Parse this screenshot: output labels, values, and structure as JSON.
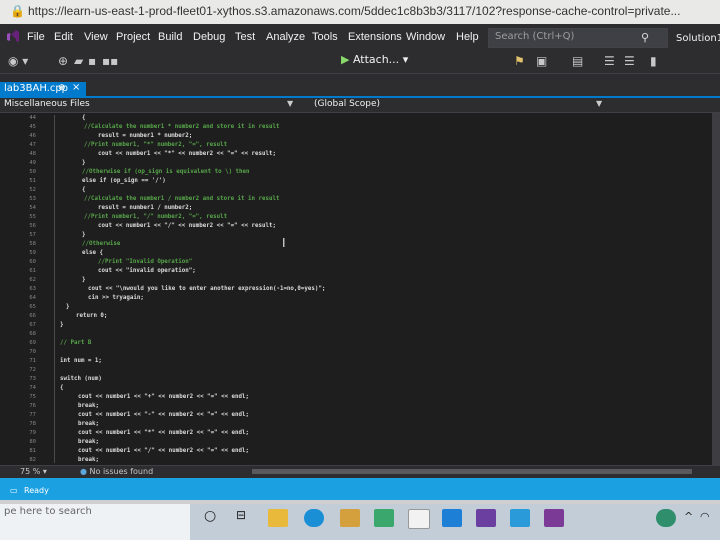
{
  "browser": {
    "lock": "🔒",
    "url": "https://learn-us-east-1-prod-fleet01-xythos.s3.amazonaws.com/5ddec1c8b3b3/3117/102?response-cache-control=private..."
  },
  "menu": [
    "File",
    "Edit",
    "View",
    "Project",
    "Build",
    "Debug",
    "Test",
    "Analyze",
    "Tools",
    "Extensions",
    "Window",
    "Help"
  ],
  "search": {
    "placeholder": "Search (Ctrl+Q)",
    "icon": "search-icon"
  },
  "solution": "Solution1",
  "toolbar": {
    "attach": "Attach...",
    "attach_dropdown": "▾"
  },
  "tab": {
    "label": "lab3BAH.cpp",
    "pin": "⊕",
    "close": "×"
  },
  "nav": {
    "scope_left": "Miscellaneous Files",
    "scope_right": "(Global Scope)"
  },
  "line_numbers": [
    "44",
    "45",
    "46",
    "47",
    "48",
    "49",
    "50",
    "51",
    "52",
    "53",
    "54",
    "55",
    "56",
    "57",
    "58",
    "59",
    "60",
    "61",
    "62",
    "63",
    "64",
    "65",
    "66",
    "67",
    "68",
    "69",
    "70",
    "71",
    "72",
    "73",
    "74",
    "75",
    "76",
    "77",
    "78",
    "79",
    "80",
    "81",
    "82"
  ],
  "code": [
    "{",
    "//Calculate the number1 * number2 and store it in result",
    "result = number1 * number2;",
    "//Print number1, \"*\" number2, \"=\", result",
    "cout << number1 << \"*\" << number2 << \"=\" << result;",
    "}",
    "//Otherwise if (op_sign is equivalent to \\) then",
    "else if (op_sign == '/')",
    "{",
    "//Calculate the number1 / number2 and store it in result",
    "result = number1 / number2;",
    "//Print number1, \"/\" number2, \"=\", result",
    "cout << number1 << \"/\" << number2 << \"=\" << result;",
    "}",
    "//Otherwise",
    "else {",
    "//Print \"Invalid Operation\"",
    "cout << \"invalid operation\";",
    "}",
    "cout << \"\\nwould you like to enter another expression(-1=no,0=yes)\";",
    "cin >> tryagain;",
    "}",
    "return 0;",
    "}",
    "",
    "// Part B",
    "",
    "int num = 1;",
    "",
    "switch (num)",
    "{",
    "cout << number1 << \"+\" << number2 << \"=\" << endl;",
    "break;",
    "cout << number1 << \"-\" << number2 << \"=\" << endl;",
    "break;",
    "cout << number1 << \"*\" << number2 << \"=\" << endl;",
    "break;",
    "cout << number1 << \"/\" << number2 << \"=\" << endl;",
    "break;"
  ],
  "footer": {
    "zoom": "75 %",
    "zoom_arrow": "▾",
    "issues": "No issues found"
  },
  "status": {
    "ready": "Ready"
  },
  "taskbar": {
    "search_text": "pe here to search"
  }
}
